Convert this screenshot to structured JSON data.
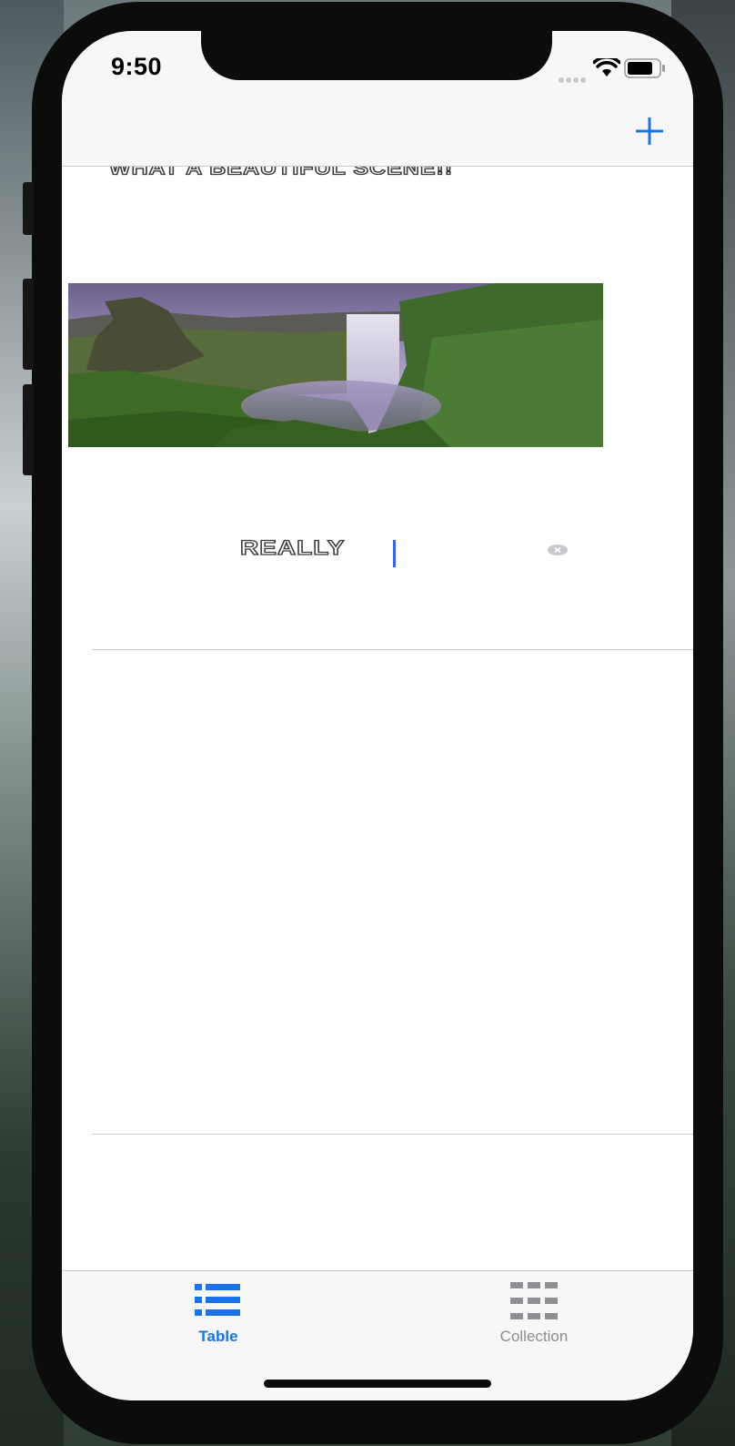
{
  "status_bar": {
    "time": "9:50"
  },
  "nav_bar": {
    "add_icon": "plus-icon",
    "accent_color": "#1a73e8"
  },
  "cells": [
    {
      "title": "WHAT A BEAUTIFUL SCENE!!",
      "image": "waterfall-landscape",
      "field_value": "REALLY"
    }
  ],
  "tab_bar": {
    "tabs": [
      {
        "label": "Table",
        "icon": "list-icon",
        "selected": true
      },
      {
        "label": "Collection",
        "icon": "grid-icon",
        "selected": false
      }
    ]
  }
}
